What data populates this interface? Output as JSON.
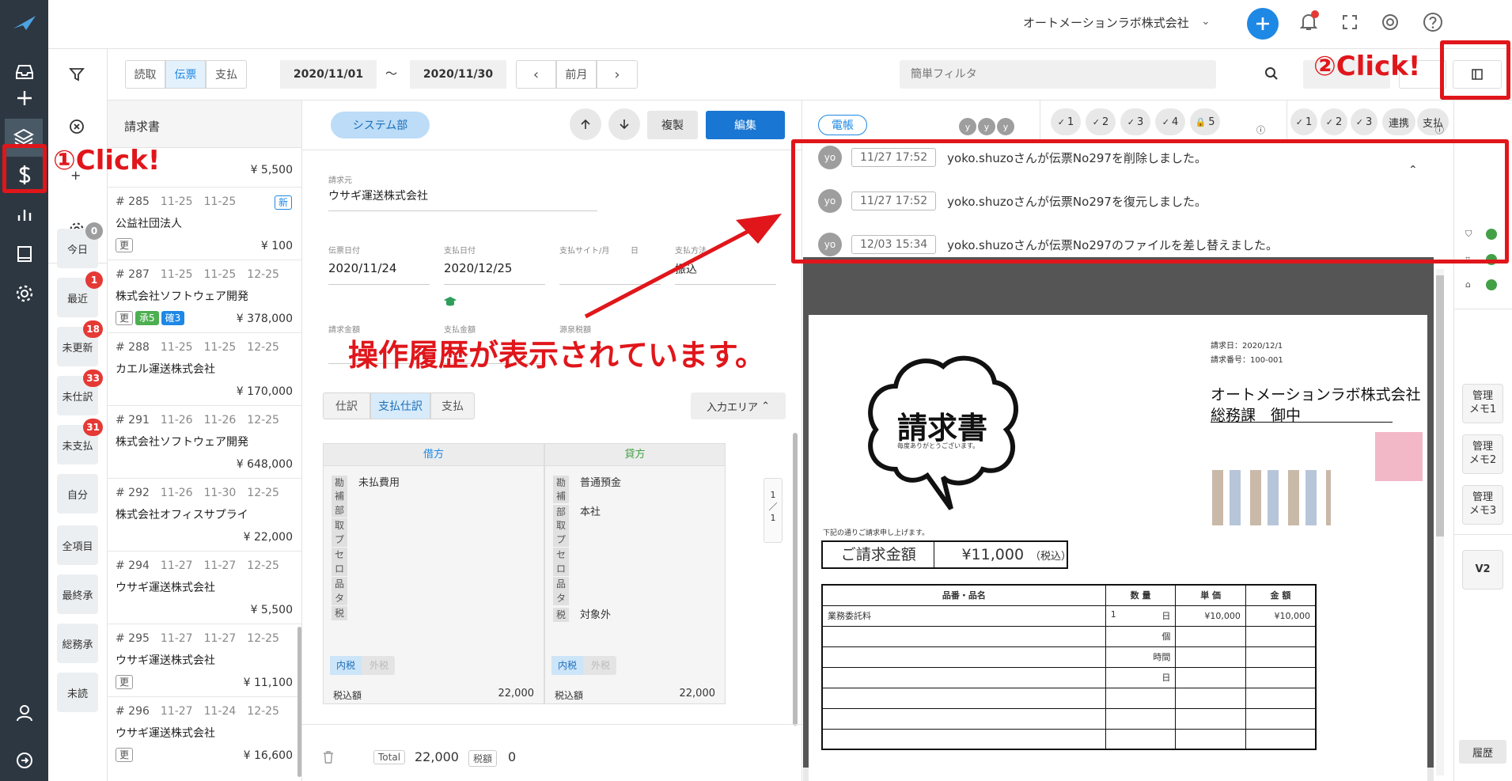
{
  "header": {
    "company": "オートメーションラボ株式会社",
    "chevron_icon": "chevron-down-icon",
    "icons": [
      "plus-icon",
      "bell-icon",
      "expand-icon",
      "lifebuoy-icon",
      "help-icon"
    ]
  },
  "leftnav": {
    "icons": [
      "logo-bird-icon",
      "inbox-icon",
      "add-icon",
      "layers-icon",
      "dollar-icon",
      "bar-chart-icon",
      "book-icon",
      "gear-icon",
      "user-icon",
      "logout-icon"
    ]
  },
  "toolcol": {
    "icons": [
      "filter-icon",
      "clear-icon",
      "plus-icon",
      "settings-icon"
    ],
    "items": [
      {
        "label": "今日",
        "badge": "0"
      },
      {
        "label": "最近",
        "badge": "1"
      },
      {
        "label": "未更新",
        "badge": "18"
      },
      {
        "label": "未仕訳",
        "badge": "33"
      },
      {
        "label": "未支払",
        "badge": "31"
      },
      {
        "label": "自分",
        "badge": ""
      },
      {
        "label": "全項目",
        "badge": ""
      },
      {
        "label": "最終承",
        "badge": ""
      },
      {
        "label": "総務承",
        "badge": ""
      },
      {
        "label": "未読",
        "badge": ""
      }
    ]
  },
  "filterbar": {
    "tabs": [
      "読取",
      "伝票",
      "支払"
    ],
    "active_tab": "伝票",
    "date_from": "2020/11/01",
    "tilde": "〜",
    "date_to": "2020/11/30",
    "prev": "‹",
    "month_label": "前月",
    "next": "›",
    "search_placeholder": "簡単フィルタ"
  },
  "doclist": {
    "title": "請求書",
    "top_amount": "¥ 5,500",
    "items": [
      {
        "num": "# 285",
        "d1": "11-25",
        "d2": "11-25",
        "d3": "",
        "name": "公益社団法人",
        "tags": [
          "更"
        ],
        "new": "新",
        "amount": "¥ 100"
      },
      {
        "num": "# 287",
        "d1": "11-25",
        "d2": "11-25",
        "d3": "12-25",
        "name": "株式会社ソフトウェア開発",
        "tags": [
          "更",
          "承5",
          "確3"
        ],
        "new": "",
        "amount": "¥ 378,000"
      },
      {
        "num": "# 288",
        "d1": "11-25",
        "d2": "11-25",
        "d3": "12-25",
        "name": "カエル運送株式会社",
        "tags": [],
        "new": "",
        "amount": "¥ 170,000"
      },
      {
        "num": "# 291",
        "d1": "11-26",
        "d2": "11-26",
        "d3": "12-25",
        "name": "株式会社ソフトウェア開発",
        "tags": [],
        "new": "",
        "amount": "¥ 648,000"
      },
      {
        "num": "# 292",
        "d1": "11-26",
        "d2": "11-30",
        "d3": "12-25",
        "name": "株式会社オフィスサプライ",
        "tags": [],
        "new": "",
        "amount": "¥ 22,000"
      },
      {
        "num": "# 294",
        "d1": "11-27",
        "d2": "11-27",
        "d3": "12-25",
        "name": "ウサギ運送株式会社",
        "tags": [],
        "new": "",
        "amount": "¥ 5,500"
      },
      {
        "num": "# 295",
        "d1": "11-27",
        "d2": "11-27",
        "d3": "12-25",
        "name": "ウサギ運送株式会社",
        "tags": [
          "更"
        ],
        "new": "",
        "amount": "¥ 11,100"
      },
      {
        "num": "# 296",
        "d1": "11-27",
        "d2": "11-24",
        "d3": "12-25",
        "name": "ウサギ運送株式会社",
        "tags": [
          "更"
        ],
        "new": "",
        "amount": "¥ 16,600"
      }
    ]
  },
  "detail": {
    "dept": "システム部",
    "copy": "複製",
    "edit": "編集",
    "src_label": "請求元",
    "src_value": "ウサギ運送株式会社",
    "slip_date_label": "伝票日付",
    "slip_date": "2020/11/24",
    "pay_date_label": "支払日付",
    "pay_date": "2020/12/25",
    "pay_site_label": "支払サイト/月",
    "day_label": "日",
    "pay_method_label": "支払方法",
    "pay_method": "振込",
    "inv_amount_label": "請求金額",
    "pay_amount_label": "支払金額",
    "withholding_label": "源泉税額",
    "tabs": [
      "仕訳",
      "支払仕訳",
      "支払"
    ],
    "active_tab": "支払仕訳",
    "input_area": "入力エリア",
    "debit": "借方",
    "credit": "貸方",
    "row_keys": [
      "勘",
      "補",
      "部",
      "取",
      "プ",
      "セ",
      "ロ",
      "品",
      "タ",
      "税"
    ],
    "debit_vals": {
      "勘": "未払費用"
    },
    "credit_vals": {
      "勘": "普通預金",
      "部": "本社",
      "税": "対象外"
    },
    "tax_in": "内税",
    "tax_out": "外税",
    "taxincl_label": "税込額",
    "debit_taxincl": "22,000",
    "credit_taxincl": "22,000",
    "page_top": "1",
    "page_sep": "／",
    "page_bottom": "1",
    "total_label": "Total",
    "total_value": "22,000",
    "tax_label": "税額",
    "tax_value": "0"
  },
  "rightpanel": {
    "denchou": "電帳",
    "avatars": [
      "y",
      "y",
      "y"
    ],
    "group1": [
      "1",
      "2",
      "3",
      "4",
      "5"
    ],
    "group2": [
      "1",
      "2",
      "3"
    ],
    "renkei": "連携",
    "shiharai": "支払",
    "history": [
      {
        "avatar": "yo",
        "time": "11/27 17:52",
        "text": "yoko.shuzoさんが伝票No297を削除しました。"
      },
      {
        "avatar": "yo",
        "time": "11/27 17:52",
        "text": "yoko.shuzoさんが伝票No297を復元しました。"
      },
      {
        "avatar": "yo",
        "time": "12/03 15:34",
        "text": "yoko.shuzoさんが伝票No297のファイルを差し替えました。"
      }
    ]
  },
  "invoice": {
    "title": "請求書",
    "subtitle": "毎度ありがとうございます。",
    "date_line": "請求日：2020/12/1",
    "num_line": "請求番号：100-001",
    "to_company": "オートメーションラボ株式会社",
    "to_dept": "総務課　御中",
    "note": "下記の通りご請求申し上げます。",
    "amount_label": "ご請求金額",
    "amount": "¥11,000",
    "amount_tax": "（税込）",
    "col_item": "品番・品名",
    "col_qty": "数 量",
    "col_price": "単 価",
    "col_amount": "金 額",
    "row1_item": "業務委託料",
    "row1_qty": "1",
    "row1_unit": "日",
    "row1_price": "¥10,000",
    "row1_amount": "¥10,000",
    "unit_rows": [
      "個",
      "時間",
      "日"
    ]
  },
  "farright": {
    "memos": [
      "管理\nメモ1",
      "管理\nメモ2",
      "管理\nメモ3"
    ],
    "v2": "V2",
    "history_btn": "履歴"
  },
  "annotations": {
    "click1": "①Click!",
    "click2": "②Click!",
    "message": "操作履歴が表示されています。",
    "color": "#e0161b"
  }
}
